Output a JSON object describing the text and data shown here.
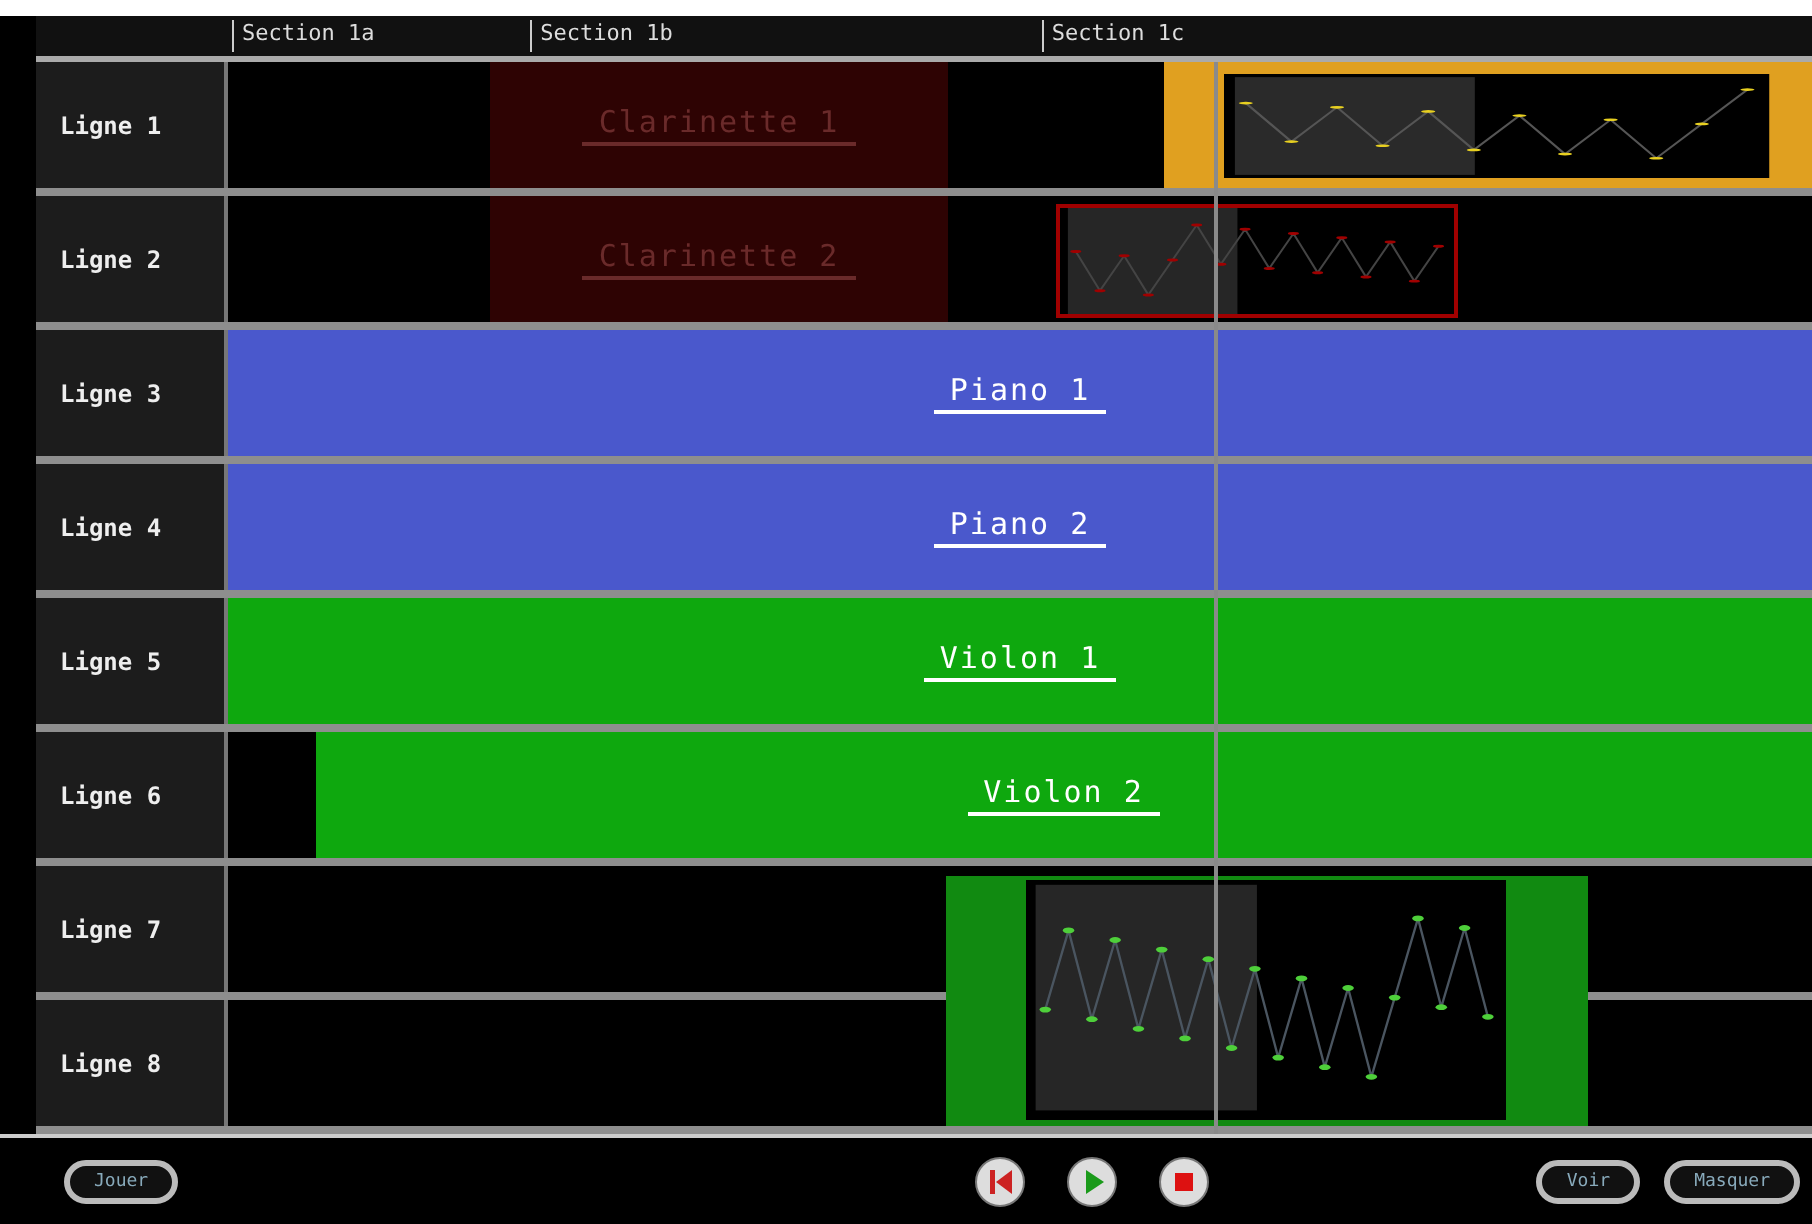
{
  "sections": [
    "Section 1a",
    "Section 1b",
    "Section 1c"
  ],
  "rows": [
    {
      "label": "Ligne 1",
      "clips": [
        {
          "kind": "block",
          "label": "Clarinette 1",
          "color": "#2e0303",
          "muted": true
        },
        {
          "kind": "pattern",
          "color": "#e0a020"
        }
      ]
    },
    {
      "label": "Ligne 2",
      "clips": [
        {
          "kind": "block",
          "label": "Clarinette 2",
          "color": "#2e0303",
          "muted": true
        },
        {
          "kind": "frame",
          "color": "#a00000"
        }
      ]
    },
    {
      "label": "Ligne 3",
      "clips": [
        {
          "kind": "block",
          "label": "Piano 1",
          "color": "#4a58cc",
          "muted": false
        }
      ]
    },
    {
      "label": "Ligne 4",
      "clips": [
        {
          "kind": "block",
          "label": "Piano 2",
          "color": "#4a58cc",
          "muted": false
        }
      ]
    },
    {
      "label": "Ligne 5",
      "clips": [
        {
          "kind": "block",
          "label": "Violon 1",
          "color": "#0ea80e",
          "muted": false
        }
      ]
    },
    {
      "label": "Ligne 6",
      "clips": [
        {
          "kind": "block",
          "label": "Violon 2",
          "color": "#0ea80e",
          "muted": false
        }
      ]
    },
    {
      "label": "Ligne 7",
      "clips": [
        {
          "kind": "span",
          "color": "#118a11"
        }
      ]
    },
    {
      "label": "Ligne 8",
      "clips": []
    }
  ],
  "buttons_left": [
    "Jouer"
  ],
  "buttons_right": [
    "Voir",
    "Masquer"
  ]
}
